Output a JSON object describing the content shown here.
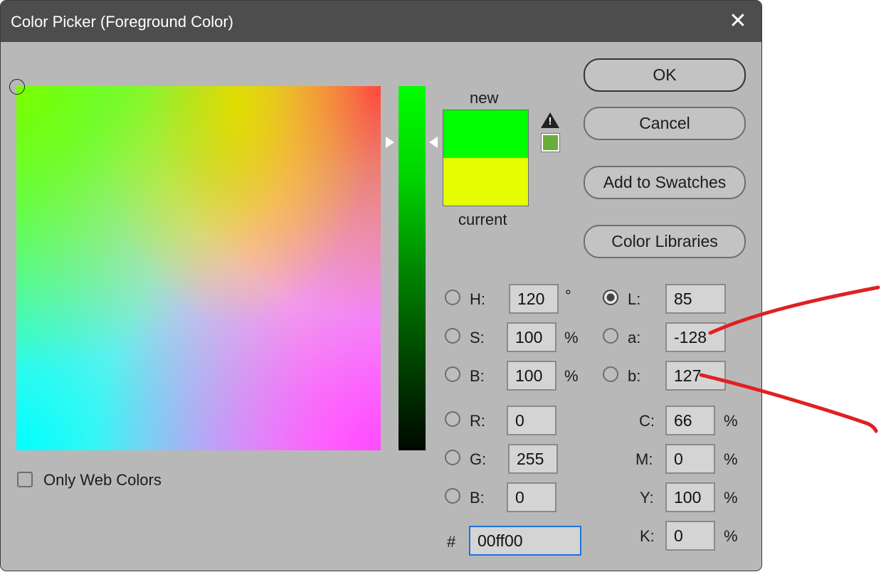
{
  "window": {
    "title": "Color Picker (Foreground Color)",
    "close_glyph": "✕"
  },
  "swatch": {
    "new_label": "new",
    "current_label": "current",
    "new_color": "#00ff00",
    "current_color": "#e5ff00",
    "gamut_color": "#6aad3a",
    "warning_icon": "out-of-gamut-warning-icon"
  },
  "buttons": {
    "ok": "OK",
    "cancel": "Cancel",
    "add_swatches": "Add to Swatches",
    "color_libraries": "Color Libraries"
  },
  "hsb": {
    "h_label": "H:",
    "h_value": "120",
    "h_unit": "°",
    "s_label": "S:",
    "s_value": "100",
    "s_unit": "%",
    "b_label": "B:",
    "b_value": "100",
    "b_unit": "%"
  },
  "rgb": {
    "r_label": "R:",
    "r_value": "0",
    "g_label": "G:",
    "g_value": "255",
    "b_label": "B:",
    "b_value": "0"
  },
  "lab": {
    "l_label": "L:",
    "l_value": "85",
    "a_label": "a:",
    "a_value": "-128",
    "b_label": "b:",
    "b_value": "127"
  },
  "cmyk": {
    "c_label": "C:",
    "c_value": "66",
    "c_unit": "%",
    "m_label": "M:",
    "m_value": "0",
    "m_unit": "%",
    "y_label": "Y:",
    "y_value": "100",
    "y_unit": "%",
    "k_label": "K:",
    "k_value": "0",
    "k_unit": "%"
  },
  "hex": {
    "label": "#",
    "value": "00ff00"
  },
  "web_colors": {
    "label": "Only Web Colors",
    "checked": false
  },
  "annotation_color": "#e02020"
}
